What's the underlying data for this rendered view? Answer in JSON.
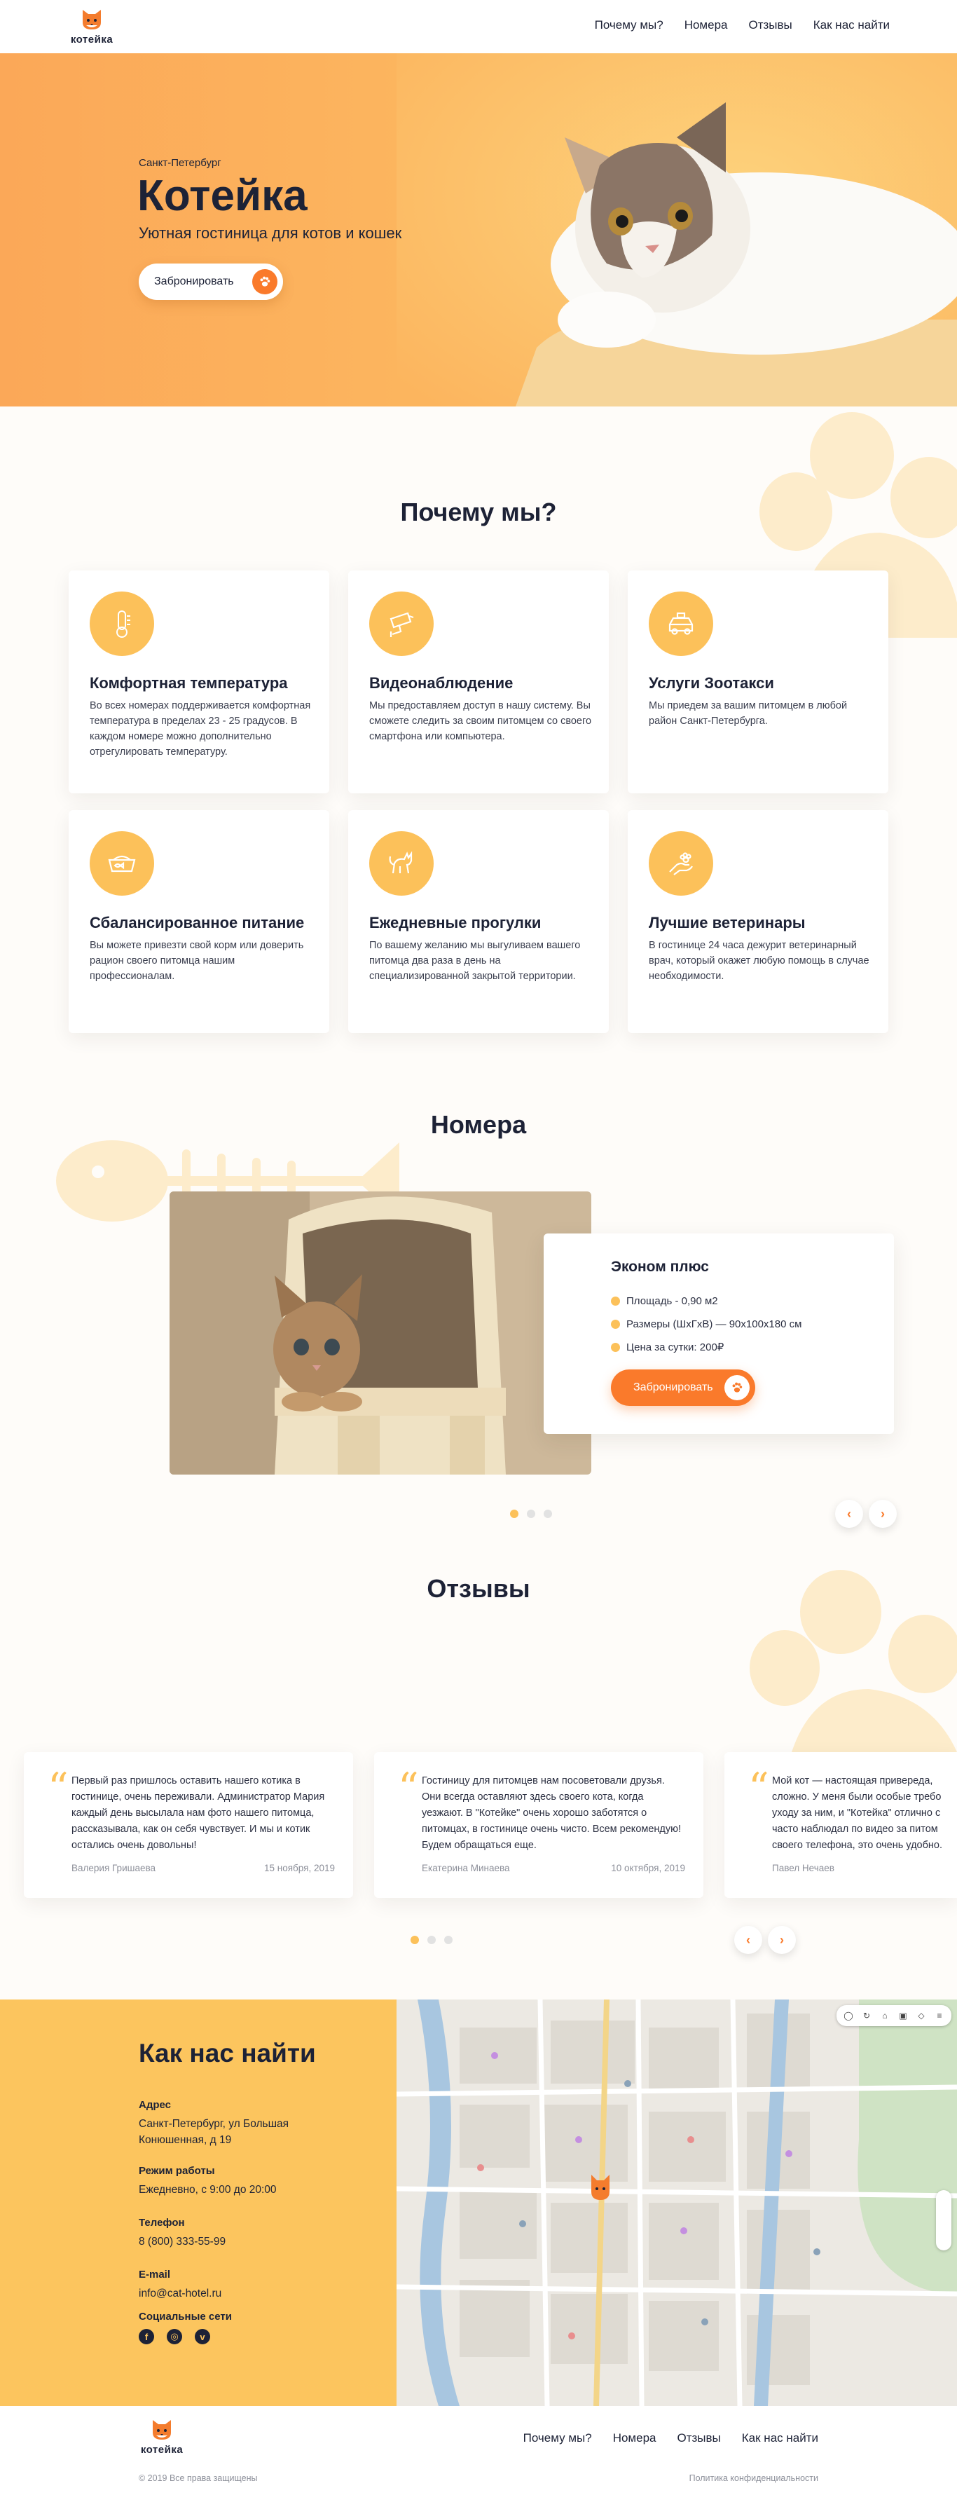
{
  "header": {
    "logo_text": "котейка",
    "nav": [
      "Почему мы?",
      "Номера",
      "Отзывы",
      "Как нас найти"
    ]
  },
  "hero": {
    "city": "Санкт-Петербург",
    "title": "Котейка",
    "subtitle": "Уютная гостиница для котов и кошек",
    "button": "Забронировать"
  },
  "why": {
    "title": "Почему мы?",
    "cards": [
      {
        "title": "Комфортная температура",
        "text": "Во всех номерах поддерживается комфортная температура в пределах 23 - 25 градусов. В каждом номере можно дополнительно отрегулировать температуру.",
        "icon": "thermometer-icon"
      },
      {
        "title": "Видеонаблюдение",
        "text": "Мы предоставляем доступ в нашу систему. Вы сможете следить за своим питомцем со своего смартфона или компьютера.",
        "icon": "cctv-camera-icon"
      },
      {
        "title": "Услуги Зоотакси",
        "text": "Мы приедем за вашим питомцем в любой район Санкт-Петербурга.",
        "icon": "taxi-icon"
      },
      {
        "title": "Сбалансированное питание",
        "text": "Вы можете привезти свой корм или доверить рацион своего питомца нашим профессионалам.",
        "icon": "food-bowl-icon"
      },
      {
        "title": "Ежедневные прогулки",
        "text": "По вашему желанию мы выгуливаем вашего питомца два раза в день на специализированной закрытой территории.",
        "icon": "walking-cat-icon"
      },
      {
        "title": "Лучшие ветеринары",
        "text": "В гостинице 24 часа дежурит ветеринарный врач, который окажет любую помощь в случае необходимости.",
        "icon": "vet-hand-icon"
      }
    ]
  },
  "rooms": {
    "title": "Номера",
    "room_name": "Эконом плюс",
    "features": [
      "Площадь - 0,90 м2",
      "Размеры (ШхГхВ) — 90х100х180 см",
      "Цена за сутки: 200₽"
    ],
    "button": "Забронировать",
    "prev": "‹",
    "next": "›"
  },
  "reviews": {
    "title": "Отзывы",
    "items": [
      {
        "text": "Первый раз пришлось оставить нашего котика в гостинице, очень переживали. Администратор Мария каждый день высылала нам фото нашего питомца, рассказывала, как он себя чувствует. И мы и котик остались очень довольны!",
        "author": "Валерия Гришаева",
        "date": "15 ноября, 2019"
      },
      {
        "text": "Гостиницу для питомцев нам посоветовали друзья. Они всегда оставляют здесь своего кота, когда уезжают. В \"Котейке\" очень хорошо заботятся о питомцах, в гостинице очень чисто. Всем рекомендую! Будем обращаться еще.",
        "author": "Екатерина Минаева",
        "date": "10 октября, 2019"
      },
      {
        "text": "Мой кот — настоящая привереда, сложно. У меня были особые требо уходу за ним, и \"Котейка\" отлично с часто наблюдал по видео за питом своего телефона, это очень удобно.",
        "author": "Павел Нечаев",
        "date": ""
      }
    ],
    "prev": "‹",
    "next": "›"
  },
  "contacts": {
    "title": "Как нас найти",
    "address_label": "Адрес",
    "address": "Санкт-Петербург, ул Большая Конюшенная, д 19",
    "hours_label": "Режим работы",
    "hours": "Ежедневно, с 9:00 до 20:00",
    "phone_label": "Телефон",
    "phone": "8 (800) 333-55-99",
    "email_label": "E-mail",
    "email": "info@cat-hotel.ru",
    "social_label": "Социальные сети"
  },
  "footer": {
    "logo_text": "котейка",
    "nav": [
      "Почему мы?",
      "Номера",
      "Отзывы",
      "Как нас найти"
    ],
    "copyright": "© 2019 Все права защищены",
    "policy": "Политика конфиденциальности"
  },
  "colors": {
    "accent": "#fa7a2b",
    "yellow": "#fcc15a",
    "dark": "#1d2236"
  }
}
